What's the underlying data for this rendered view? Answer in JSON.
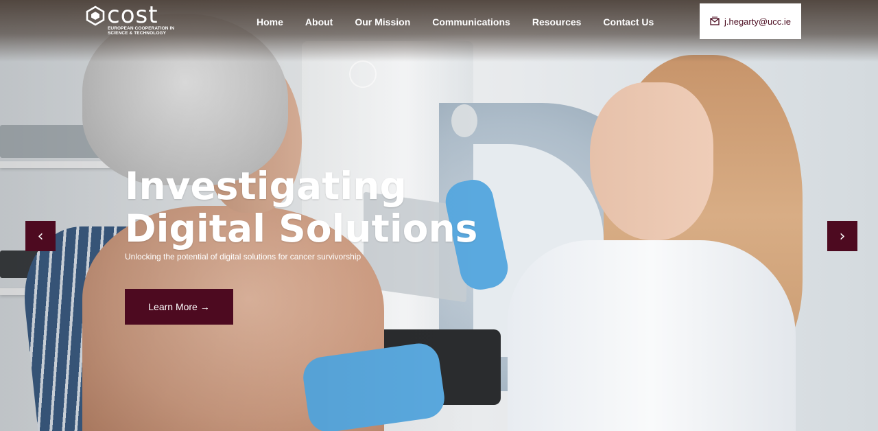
{
  "brand": {
    "logo_word": "cost",
    "logo_sub": "EUROPEAN COOPERATION IN SCIENCE & TECHNOLOGY"
  },
  "nav": {
    "items": [
      {
        "label": "Home"
      },
      {
        "label": "About"
      },
      {
        "label": "Our Mission"
      },
      {
        "label": "Communications"
      },
      {
        "label": "Resources"
      },
      {
        "label": "Contact Us"
      }
    ]
  },
  "contact": {
    "email": "j.hegarty@ucc.ie",
    "icon": "envelope-icon"
  },
  "hero": {
    "headline_line1": "Investigating",
    "headline_line2": "Digital Solutions",
    "subheadline": "Unlocking the potential of digital solutions for cancer survivorship",
    "cta_label": "Learn More →"
  },
  "carousel": {
    "prev_icon": "‹",
    "next_icon": "›"
  },
  "colors": {
    "accent": "#4d0a20",
    "email_text": "#4a0a1e"
  }
}
